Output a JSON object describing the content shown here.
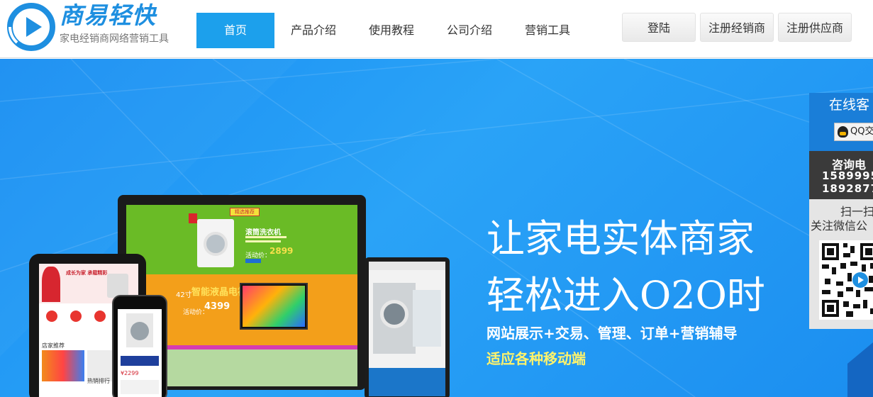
{
  "brand": {
    "name": "商易轻快",
    "slogan": "家电经销商网络营销工具",
    "color": "#1e8fe0"
  },
  "nav": {
    "items": [
      {
        "label": "首页",
        "active": true
      },
      {
        "label": "产品介绍"
      },
      {
        "label": "使用教程"
      },
      {
        "label": "公司介绍"
      },
      {
        "label": "营销工具"
      }
    ]
  },
  "header_buttons": {
    "login": "登陆",
    "register_dealer": "注册经销商",
    "register_supplier": "注册供应商"
  },
  "banner": {
    "title_line1": "让家电实体商家",
    "title_line2": "轻松进入O2O时",
    "subtitle1": "网站展示+交易、管理、订单+营销辅导",
    "subtitle2": "适应各种移动端",
    "subtitle1_color": "#ffffff",
    "subtitle2_color": "#fff36b",
    "bg_color": "#1b93f2"
  },
  "devices": {
    "desktop_screen": {
      "badge": "精选推荐",
      "washer_title": "滚筒洗衣机",
      "washer_promo": "活动价：",
      "washer_price": "2899",
      "tv_size": "42寸",
      "tv_title": "智能液晶电视",
      "tv_promo": "活动价：",
      "tv_price": "4399"
    },
    "tablet_screen": {
      "banner_text": "成长为家 承载精彩",
      "store_label": "店家推荐",
      "hot_label": "热销排行"
    },
    "phone_screen": {
      "price": "¥2299"
    }
  },
  "service_panel": {
    "title": "在线客",
    "qq_label": "QQ交",
    "tel_title": "咨询电",
    "tel_numbers": [
      "1589995",
      "1892877"
    ],
    "scan_line1": "扫一扫",
    "scan_line2": "关注微信公"
  }
}
